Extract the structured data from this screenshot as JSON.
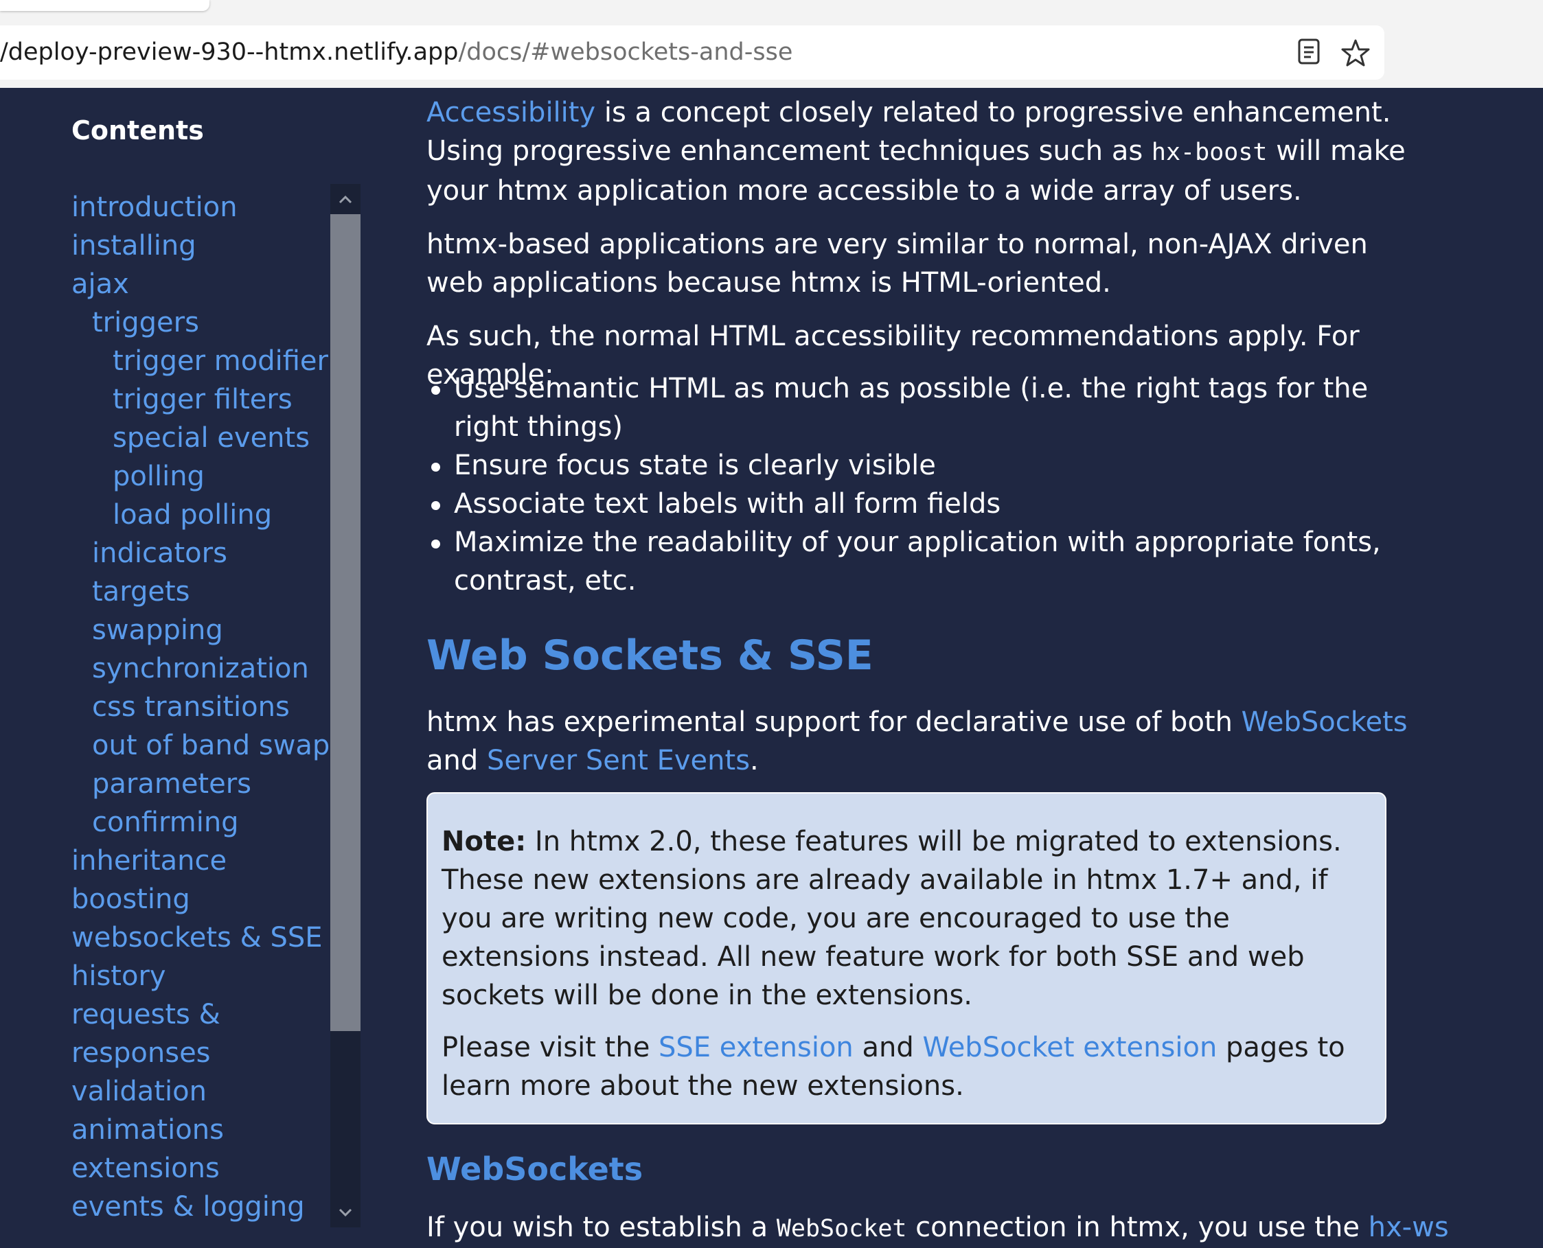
{
  "browser": {
    "url_host": "/deploy-preview-930--htmx.netlify.app",
    "url_path": "/docs/#websockets-and-sse",
    "reader_icon": "reader-mode-icon",
    "star_icon": "bookmark-star-icon"
  },
  "sidebar": {
    "title": "Contents",
    "items": [
      {
        "label": "introduction"
      },
      {
        "label": "installing"
      },
      {
        "label": "ajax"
      },
      {
        "label": "triggers"
      },
      {
        "label": "trigger modifiers"
      },
      {
        "label": "trigger filters"
      },
      {
        "label": "special events"
      },
      {
        "label": "polling"
      },
      {
        "label": "load polling"
      },
      {
        "label": "indicators"
      },
      {
        "label": "targets"
      },
      {
        "label": "swapping"
      },
      {
        "label": "synchronization"
      },
      {
        "label": "css transitions"
      },
      {
        "label": "out of band swaps"
      },
      {
        "label": "parameters"
      },
      {
        "label": "confirming"
      },
      {
        "label": "inheritance"
      },
      {
        "label": "boosting"
      },
      {
        "label": "websockets & SSE"
      },
      {
        "label": "history"
      },
      {
        "label": "requests &"
      },
      {
        "label": "responses"
      },
      {
        "label": "validation"
      },
      {
        "label": "animations"
      },
      {
        "label": "extensions"
      },
      {
        "label": "events & logging"
      }
    ]
  },
  "main": {
    "p1": {
      "link": "Accessibility",
      "t1": " is a concept closely related to progressive enhancement. Using progressive enhancement techniques such as ",
      "code": "hx-boost",
      "t2": " will make your htmx application more accessible to a wide array of users."
    },
    "p2": "htmx-based applications are very similar to normal, non-AJAX driven web applications because htmx is HTML-oriented.",
    "p3": "As such, the normal HTML accessibility recommendations apply. For example:",
    "bullets": [
      "Use semantic HTML as much as possible (i.e. the right tags for the right things)",
      "Ensure focus state is clearly visible",
      "Associate text labels with all form fields",
      "Maximize the readability of your application with appropriate fonts, contrast, etc."
    ],
    "h2": "Web Sockets & SSE",
    "ws_intro": {
      "t1": "htmx has experimental support for declarative use of both ",
      "link1": "WebSockets",
      "t2": " and ",
      "link2": "Server Sent Events",
      "t3": "."
    },
    "note": {
      "bold": "Note:",
      "text": " In htmx 2.0, these features will be migrated to extensions. These new extensions are already available in htmx 1.7+ and, if you are writing new code, you are encouraged to use the extensions instead. All new feature work for both SSE and web sockets will be done in the extensions.",
      "p2_t1": "Please visit the ",
      "p2_link1": "SSE extension",
      "p2_t2": " and ",
      "p2_link2": "WebSocket extension",
      "p2_t3": " pages to learn more about the new extensions."
    },
    "h3": "WebSockets",
    "last": {
      "t1": "If you wish to establish a ",
      "code": "WebSocket",
      "t2": " connection in htmx, you use the ",
      "link": "hx-ws"
    }
  },
  "colors": {
    "background": "#1f2742",
    "link": "#5b9cec",
    "heading": "#4d8fe0",
    "note_bg": "#d0dcef"
  }
}
